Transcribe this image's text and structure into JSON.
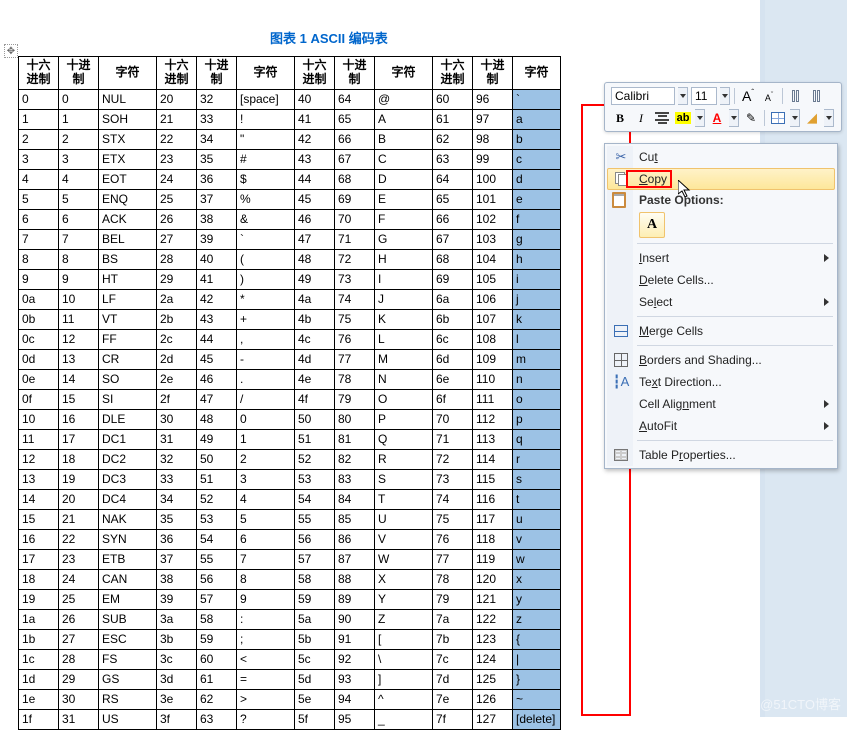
{
  "title": "图表 1 ASCII 编码表",
  "anchor_glyph": "✥",
  "headers": {
    "hex": "十六\n进制",
    "dec": "十进\n制",
    "char": "字符"
  },
  "rows": [
    {
      "h1": "0",
      "d1": "0",
      "c1": "NUL",
      "h2": "20",
      "d2": "32",
      "c2": "[space]",
      "h3": "40",
      "d3": "64",
      "c3": "@",
      "h4": "60",
      "d4": "96",
      "c4": "`"
    },
    {
      "h1": "1",
      "d1": "1",
      "c1": "SOH",
      "h2": "21",
      "d2": "33",
      "c2": "!",
      "h3": "41",
      "d3": "65",
      "c3": "A",
      "h4": "61",
      "d4": "97",
      "c4": "a"
    },
    {
      "h1": "2",
      "d1": "2",
      "c1": "STX",
      "h2": "22",
      "d2": "34",
      "c2": "\"",
      "h3": "42",
      "d3": "66",
      "c3": "B",
      "h4": "62",
      "d4": "98",
      "c4": "b"
    },
    {
      "h1": "3",
      "d1": "3",
      "c1": "ETX",
      "h2": "23",
      "d2": "35",
      "c2": "#",
      "h3": "43",
      "d3": "67",
      "c3": "C",
      "h4": "63",
      "d4": "99",
      "c4": "c"
    },
    {
      "h1": "4",
      "d1": "4",
      "c1": "EOT",
      "h2": "24",
      "d2": "36",
      "c2": "$",
      "h3": "44",
      "d3": "68",
      "c3": "D",
      "h4": "64",
      "d4": "100",
      "c4": "d"
    },
    {
      "h1": "5",
      "d1": "5",
      "c1": "ENQ",
      "h2": "25",
      "d2": "37",
      "c2": "%",
      "h3": "45",
      "d3": "69",
      "c3": "E",
      "h4": "65",
      "d4": "101",
      "c4": "e"
    },
    {
      "h1": "6",
      "d1": "6",
      "c1": "ACK",
      "h2": "26",
      "d2": "38",
      "c2": "&",
      "h3": "46",
      "d3": "70",
      "c3": "F",
      "h4": "66",
      "d4": "102",
      "c4": "f"
    },
    {
      "h1": "7",
      "d1": "7",
      "c1": "BEL",
      "h2": "27",
      "d2": "39",
      "c2": "`",
      "h3": "47",
      "d3": "71",
      "c3": "G",
      "h4": "67",
      "d4": "103",
      "c4": "g"
    },
    {
      "h1": "8",
      "d1": "8",
      "c1": "BS",
      "h2": "28",
      "d2": "40",
      "c2": "(",
      "h3": "48",
      "d3": "72",
      "c3": "H",
      "h4": "68",
      "d4": "104",
      "c4": "h"
    },
    {
      "h1": "9",
      "d1": "9",
      "c1": "HT",
      "h2": "29",
      "d2": "41",
      "c2": ")",
      "h3": "49",
      "d3": "73",
      "c3": "I",
      "h4": "69",
      "d4": "105",
      "c4": "i"
    },
    {
      "h1": "0a",
      "d1": "10",
      "c1": "LF",
      "h2": "2a",
      "d2": "42",
      "c2": "*",
      "h3": "4a",
      "d3": "74",
      "c3": "J",
      "h4": "6a",
      "d4": "106",
      "c4": "j"
    },
    {
      "h1": "0b",
      "d1": "11",
      "c1": "VT",
      "h2": "2b",
      "d2": "43",
      "c2": "+",
      "h3": "4b",
      "d3": "75",
      "c3": "K",
      "h4": "6b",
      "d4": "107",
      "c4": "k"
    },
    {
      "h1": "0c",
      "d1": "12",
      "c1": "FF",
      "h2": "2c",
      "d2": "44",
      "c2": ",",
      "h3": "4c",
      "d3": "76",
      "c3": "L",
      "h4": "6c",
      "d4": "108",
      "c4": "l"
    },
    {
      "h1": "0d",
      "d1": "13",
      "c1": "CR",
      "h2": "2d",
      "d2": "45",
      "c2": "-",
      "h3": "4d",
      "d3": "77",
      "c3": "M",
      "h4": "6d",
      "d4": "109",
      "c4": "m"
    },
    {
      "h1": "0e",
      "d1": "14",
      "c1": "SO",
      "h2": "2e",
      "d2": "46",
      "c2": ".",
      "h3": "4e",
      "d3": "78",
      "c3": "N",
      "h4": "6e",
      "d4": "110",
      "c4": "n"
    },
    {
      "h1": "0f",
      "d1": "15",
      "c1": "SI",
      "h2": "2f",
      "d2": "47",
      "c2": "/",
      "h3": "4f",
      "d3": "79",
      "c3": "O",
      "h4": "6f",
      "d4": "111",
      "c4": "o"
    },
    {
      "h1": "10",
      "d1": "16",
      "c1": "DLE",
      "h2": "30",
      "d2": "48",
      "c2": "0",
      "h3": "50",
      "d3": "80",
      "c3": "P",
      "h4": "70",
      "d4": "112",
      "c4": "p"
    },
    {
      "h1": "11",
      "d1": "17",
      "c1": "DC1",
      "h2": "31",
      "d2": "49",
      "c2": "1",
      "h3": "51",
      "d3": "81",
      "c3": "Q",
      "h4": "71",
      "d4": "113",
      "c4": "q"
    },
    {
      "h1": "12",
      "d1": "18",
      "c1": "DC2",
      "h2": "32",
      "d2": "50",
      "c2": "2",
      "h3": "52",
      "d3": "82",
      "c3": "R",
      "h4": "72",
      "d4": "114",
      "c4": "r"
    },
    {
      "h1": "13",
      "d1": "19",
      "c1": "DC3",
      "h2": "33",
      "d2": "51",
      "c2": "3",
      "h3": "53",
      "d3": "83",
      "c3": "S",
      "h4": "73",
      "d4": "115",
      "c4": "s"
    },
    {
      "h1": "14",
      "d1": "20",
      "c1": "DC4",
      "h2": "34",
      "d2": "52",
      "c2": "4",
      "h3": "54",
      "d3": "84",
      "c3": "T",
      "h4": "74",
      "d4": "116",
      "c4": "t"
    },
    {
      "h1": "15",
      "d1": "21",
      "c1": "NAK",
      "h2": "35",
      "d2": "53",
      "c2": "5",
      "h3": "55",
      "d3": "85",
      "c3": "U",
      "h4": "75",
      "d4": "117",
      "c4": "u"
    },
    {
      "h1": "16",
      "d1": "22",
      "c1": "SYN",
      "h2": "36",
      "d2": "54",
      "c2": "6",
      "h3": "56",
      "d3": "86",
      "c3": "V",
      "h4": "76",
      "d4": "118",
      "c4": "v"
    },
    {
      "h1": "17",
      "d1": "23",
      "c1": "ETB",
      "h2": "37",
      "d2": "55",
      "c2": "7",
      "h3": "57",
      "d3": "87",
      "c3": "W",
      "h4": "77",
      "d4": "119",
      "c4": "w"
    },
    {
      "h1": "18",
      "d1": "24",
      "c1": "CAN",
      "h2": "38",
      "d2": "56",
      "c2": "8",
      "h3": "58",
      "d3": "88",
      "c3": "X",
      "h4": "78",
      "d4": "120",
      "c4": "x"
    },
    {
      "h1": "19",
      "d1": "25",
      "c1": "EM",
      "h2": "39",
      "d2": "57",
      "c2": "9",
      "h3": "59",
      "d3": "89",
      "c3": "Y",
      "h4": "79",
      "d4": "121",
      "c4": "y"
    },
    {
      "h1": "1a",
      "d1": "26",
      "c1": "SUB",
      "h2": "3a",
      "d2": "58",
      "c2": ":",
      "h3": "5a",
      "d3": "90",
      "c3": "Z",
      "h4": "7a",
      "d4": "122",
      "c4": "z"
    },
    {
      "h1": "1b",
      "d1": "27",
      "c1": "ESC",
      "h2": "3b",
      "d2": "59",
      "c2": ";",
      "h3": "5b",
      "d3": "91",
      "c3": "[",
      "h4": "7b",
      "d4": "123",
      "c4": "{"
    },
    {
      "h1": "1c",
      "d1": "28",
      "c1": "FS",
      "h2": "3c",
      "d2": "60",
      "c2": "<",
      "h3": "5c",
      "d3": "92",
      "c3": "\\",
      "h4": "7c",
      "d4": "124",
      "c4": "|"
    },
    {
      "h1": "1d",
      "d1": "29",
      "c1": "GS",
      "h2": "3d",
      "d2": "61",
      "c2": "=",
      "h3": "5d",
      "d3": "93",
      "c3": "]",
      "h4": "7d",
      "d4": "125",
      "c4": "}"
    },
    {
      "h1": "1e",
      "d1": "30",
      "c1": "RS",
      "h2": "3e",
      "d2": "62",
      "c2": ">",
      "h3": "5e",
      "d3": "94",
      "c3": "^",
      "h4": "7e",
      "d4": "126",
      "c4": "~"
    },
    {
      "h1": "1f",
      "d1": "31",
      "c1": "US",
      "h2": "3f",
      "d2": "63",
      "c2": "?",
      "h3": "5f",
      "d3": "95",
      "c3": "_",
      "h4": "7f",
      "d4": "127",
      "c4": "[delete]"
    }
  ],
  "minitoolbar": {
    "font_name": "Calibri",
    "font_size": "11",
    "grow_font": "A",
    "shrink_font": "A",
    "bold": "B",
    "italic": "I",
    "highlight": "ab",
    "font_color": "A",
    "format_painter": "✎",
    "bucket": "◢"
  },
  "context_menu": {
    "cut": "Cut",
    "copy": "Copy",
    "paste_options": "Paste Options:",
    "paste_keep_fmt": "A",
    "insert": "Insert",
    "delete_cells": "Delete Cells...",
    "select": "Select",
    "merge_cells": "Merge Cells",
    "borders_shading": "Borders and Shading...",
    "text_direction": "Text Direction...",
    "cell_alignment": "Cell Alignment",
    "autofit": "AutoFit",
    "table_properties": "Table Properties..."
  },
  "watermark": "@51CTO博客"
}
